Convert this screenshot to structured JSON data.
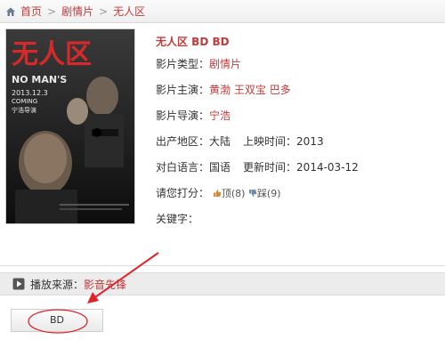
{
  "breadcrumb": {
    "home": "首页",
    "category": "剧情片",
    "current": "无人区",
    "sep": ">"
  },
  "poster": {
    "title_art": "无人区",
    "date": "2013.12.3",
    "coming": "COMING",
    "director_tag": "宁浩导演",
    "en_title": "NO MAN'S"
  },
  "movie": {
    "title": "无人区 BD BD",
    "genre_label": "影片类型：",
    "genre": "剧情片",
    "cast_label": "影片主演：",
    "cast": [
      "黄渤",
      "王双宝",
      "巴多"
    ],
    "director_label": "影片导演：",
    "director": "宁浩",
    "region_label": "出产地区：",
    "region": "大陆",
    "release_label": "上映时间：",
    "release": "2013",
    "lang_label": "对白语言：",
    "lang": "国语",
    "updated_label": "更新时间：",
    "updated": "2014-03-12",
    "rating_label": "请您打分：",
    "up_text": "顶(8)",
    "down_text": "踩(9)",
    "keywords_label": "关键字："
  },
  "source": {
    "label": "播放来源：",
    "name": "影音先锋"
  },
  "quality_button": "BD",
  "colors": {
    "accent": "#c43b3b",
    "annotation": "#e0232a"
  }
}
